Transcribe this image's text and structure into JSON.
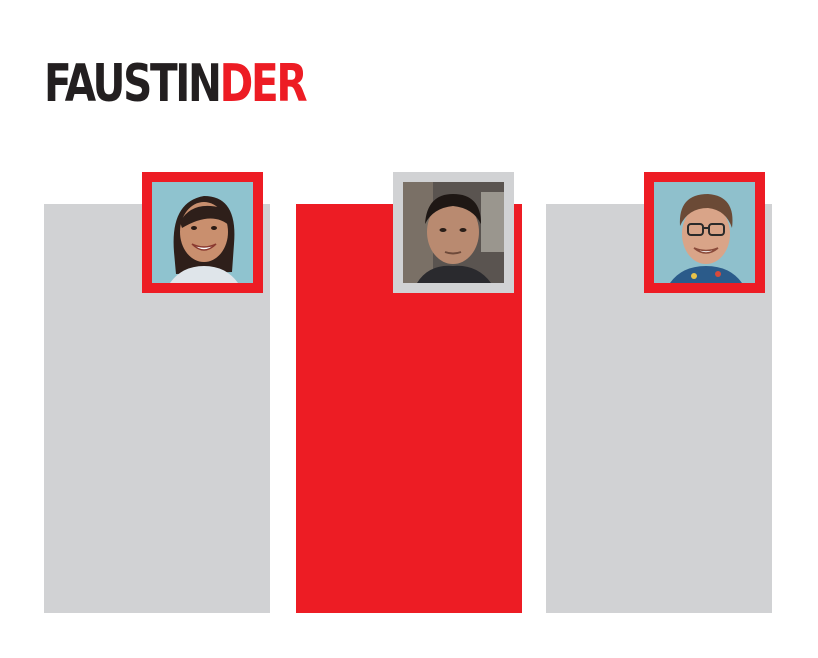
{
  "app": {
    "logo_dark": "FAUSTIN",
    "logo_accent": "DER"
  },
  "colors": {
    "accent": "#ed1c24",
    "card_grey": "#d1d2d4",
    "logo_dark": "#231f20"
  },
  "cards": [
    {
      "style": "grey",
      "avatar_border": "red",
      "avatar": "woman-smiling-photo"
    },
    {
      "style": "red",
      "avatar_border": "grey",
      "avatar": "man-dark-hair-photo"
    },
    {
      "style": "grey",
      "avatar_border": "red",
      "avatar": "man-glasses-photo"
    }
  ]
}
